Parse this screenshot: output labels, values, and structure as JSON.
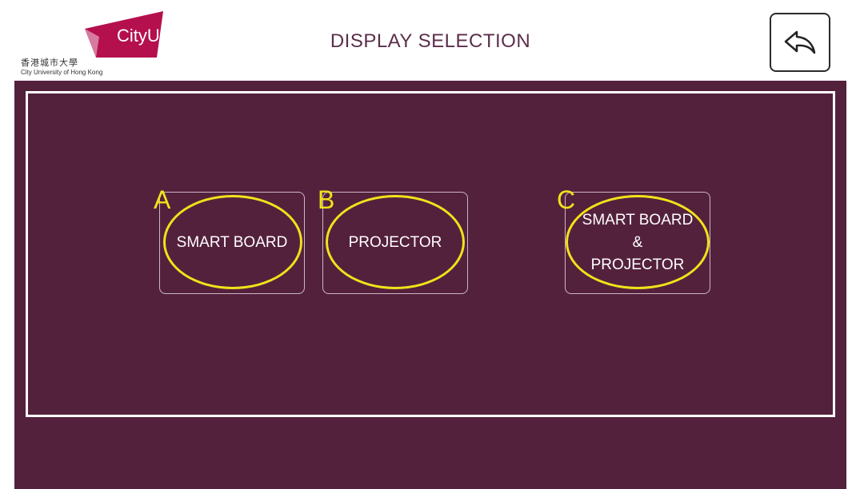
{
  "logo": {
    "brand_text": "CityU",
    "chinese_name": "香港城市大學",
    "english_name": "City University of Hong Kong",
    "brand_color": "#b5104e"
  },
  "header": {
    "title": "DISPLAY SELECTION",
    "back_icon": "reply-arrow-icon"
  },
  "options": [
    {
      "marker": "A",
      "label": "SMART BOARD"
    },
    {
      "marker": "B",
      "label": "PROJECTOR"
    },
    {
      "marker": "C",
      "label_lines": [
        "SMART BOARD",
        "&",
        "PROJECTOR"
      ]
    }
  ],
  "colors": {
    "background": "#54213d",
    "annotation": "#f1e21a",
    "title": "#5b2e4b"
  }
}
